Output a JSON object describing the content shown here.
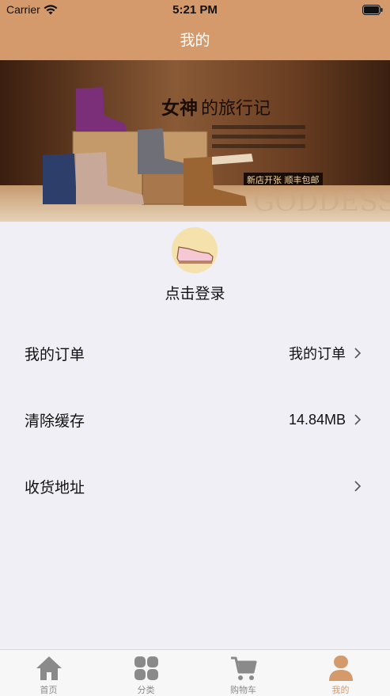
{
  "status_bar": {
    "carrier": "Carrier",
    "time": "5:21 PM"
  },
  "nav": {
    "title": "我的"
  },
  "banner": {
    "title_bold": "女神",
    "title_rest": "的旅行记",
    "tag": "新店开张 顺丰包邮",
    "watermark": "GODDESS"
  },
  "profile": {
    "login_label": "点击登录"
  },
  "menu": [
    {
      "label": "我的订单",
      "value": "我的订单"
    },
    {
      "label": "清除缓存",
      "value": "14.84MB"
    },
    {
      "label": "收货地址",
      "value": ""
    }
  ],
  "tabs": [
    {
      "label": "首页",
      "icon": "home-icon"
    },
    {
      "label": "分类",
      "icon": "grid-icon"
    },
    {
      "label": "购物车",
      "icon": "cart-icon"
    },
    {
      "label": "我的",
      "icon": "person-icon"
    }
  ],
  "colors": {
    "accent": "#d49a6c",
    "tab_inactive": "#8a8a8a",
    "background": "#f0eff5"
  }
}
